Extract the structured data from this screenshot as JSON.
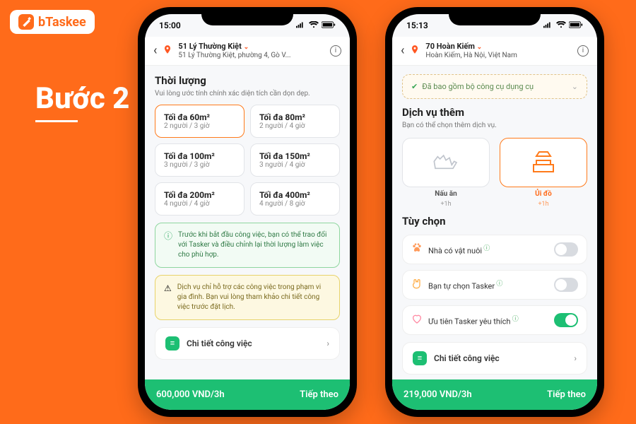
{
  "brand": {
    "name": "bTaskee"
  },
  "step": {
    "label": "Bước 2"
  },
  "status": {
    "time1": "15:00",
    "time2": "15:13"
  },
  "phone1": {
    "address": {
      "line1": "51 Lý Thường Kiệt",
      "line2": "51 Lý Thường Kiệt, phường 4, Gò V..."
    },
    "duration": {
      "title": "Thời lượng",
      "sub": "Vui lòng ước tính chính xác diện tích cần dọn dẹp."
    },
    "options": [
      {
        "t": "Tối đa 60m²",
        "s": "2 người / 3 giờ"
      },
      {
        "t": "Tối đa 80m²",
        "s": "2 người / 4 giờ"
      },
      {
        "t": "Tối đa 100m²",
        "s": "3 người / 3 giờ"
      },
      {
        "t": "Tối đa 150m²",
        "s": "3 người / 4 giờ"
      },
      {
        "t": "Tối đa 200m²",
        "s": "4 người / 4 giờ"
      },
      {
        "t": "Tối đa 400m²",
        "s": "4 người / 8 giờ"
      }
    ],
    "info_green": "Trước khi bắt đầu công việc, bạn có thể trao đổi với Tasker và điều chỉnh lại thời lượng làm việc cho phù hợp.",
    "info_yellow": "Dịch vụ chỉ hỗ trợ các công việc trong phạm vi gia đình. Bạn vui lòng tham khảo chi tiết công việc trước đặt lịch.",
    "detail_label": "Chi tiết công việc",
    "footer": {
      "price": "600,000 VND/3h",
      "next": "Tiếp theo"
    }
  },
  "phone2": {
    "address": {
      "line1": "70 Hoàn Kiếm",
      "line2": "Hoàn Kiếm, Hà Nội, Việt Nam"
    },
    "tools_pill": "Đã bao gồm bộ công cụ dụng cụ",
    "extra": {
      "title": "Dịch vụ thêm",
      "sub": "Bạn có thể chọn thêm dịch vụ."
    },
    "tiles": [
      {
        "label": "Nấu ăn",
        "sub": "+1h"
      },
      {
        "label": "Ủi đồ",
        "sub": "+1h"
      }
    ],
    "opts_title": "Tùy chọn",
    "opts": [
      {
        "label": "Nhà có vật nuôi"
      },
      {
        "label": "Bạn tự chọn Tasker"
      },
      {
        "label": "Ưu tiên Tasker yêu thích"
      }
    ],
    "detail_label": "Chi tiết công việc",
    "footer": {
      "price": "219,000 VND/3h",
      "next": "Tiếp theo"
    }
  }
}
